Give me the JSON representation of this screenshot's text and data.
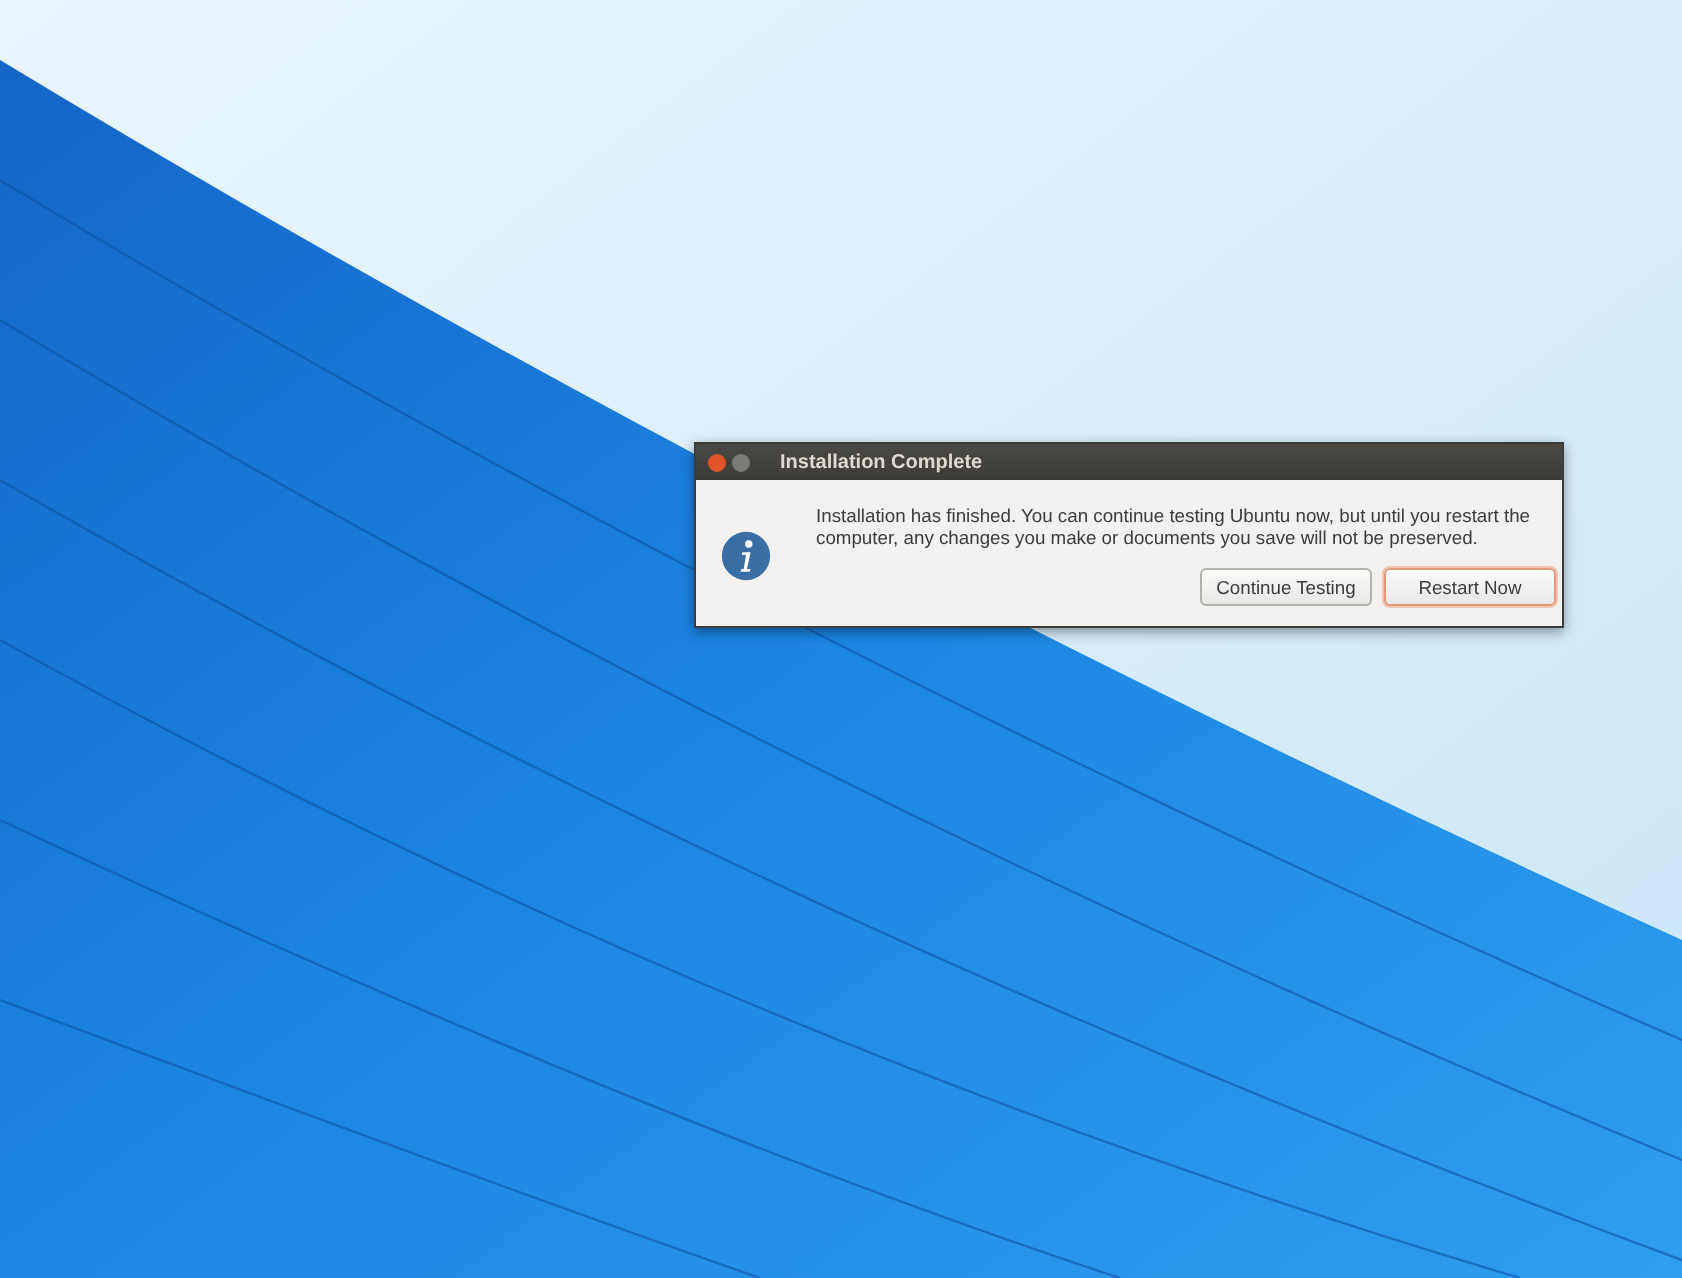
{
  "dialog": {
    "title": "Installation Complete",
    "message": "Installation has finished.  You can continue testing Ubuntu now, but until you restart the computer, any changes you make or documents you save will not be preserved.",
    "buttons": [
      {
        "label": "Continue Testing",
        "default": false
      },
      {
        "label": "Restart Now",
        "default": true
      }
    ]
  }
}
